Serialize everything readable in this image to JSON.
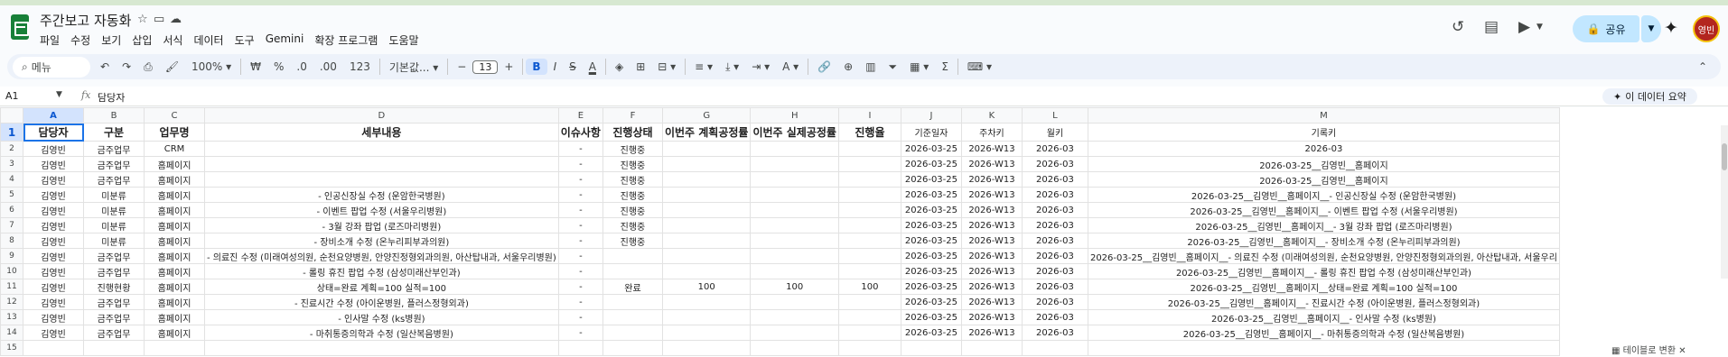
{
  "app": {
    "title": "주간보고 자동화",
    "menus": [
      "파일",
      "수정",
      "보기",
      "삽입",
      "서식",
      "데이터",
      "도구",
      "Gemini",
      "확장 프로그램",
      "도움말"
    ],
    "share_label": "공유",
    "avatar_text": "영빈"
  },
  "toolbar": {
    "search_placeholder": "메뉴",
    "zoom": "100%",
    "currency": "₩",
    "percent": "%",
    "dec_decrease": ".0",
    "dec_increase": ".00",
    "number_format": "123",
    "font": "기본값...",
    "font_size": "13",
    "bold": "B",
    "italic": "I",
    "strike": "S",
    "text_color": "A"
  },
  "formula": {
    "cell_ref": "A1",
    "value": "담당자",
    "summary_button": "이 데이터 요약"
  },
  "sheet": {
    "columns": [
      "A",
      "B",
      "C",
      "D",
      "E",
      "F",
      "G",
      "H",
      "I",
      "J",
      "K",
      "L",
      "M"
    ],
    "headers": [
      "담당자",
      "구분",
      "업무명",
      "세부내용",
      "이슈사항",
      "진행상태",
      "이번주 계획공정률",
      "이번주 실제공정률",
      "진행율",
      "기준일자",
      "주차키",
      "월키",
      "기록키"
    ],
    "rows": [
      [
        "김영빈",
        "금주업무",
        "CRM",
        "",
        "-",
        "진행중",
        "",
        "",
        "",
        "2026-03-25",
        "2026-W13",
        "2026-03",
        "2026-03"
      ],
      [
        "김영빈",
        "금주업무",
        "홈페이지",
        "",
        "-",
        "진행중",
        "",
        "",
        "",
        "2026-03-25",
        "2026-W13",
        "2026-03",
        "2026-03-25__김영빈__홈페이지"
      ],
      [
        "김영빈",
        "금주업무",
        "홈페이지",
        "",
        "-",
        "진행중",
        "",
        "",
        "",
        "2026-03-25",
        "2026-W13",
        "2026-03",
        "2026-03-25__김영빈__홈페이지"
      ],
      [
        "김영빈",
        "미분류",
        "홈페이지",
        "- 인공신장실 수정 (운암한국병원)",
        "-",
        "진행중",
        "",
        "",
        "",
        "2026-03-25",
        "2026-W13",
        "2026-03",
        "2026-03-25__김영빈__홈페이지__- 인공신장실 수정 (운암한국병원)"
      ],
      [
        "김영빈",
        "미분류",
        "홈페이지",
        "- 이벤트 팝업 수정 (서울우리병원)",
        "-",
        "진행중",
        "",
        "",
        "",
        "2026-03-25",
        "2026-W13",
        "2026-03",
        "2026-03-25__김영빈__홈페이지__- 이벤트 팝업 수정 (서울우리병원)"
      ],
      [
        "김영빈",
        "미분류",
        "홈페이지",
        "- 3월 강좌 팝업 (로즈마리병원)",
        "-",
        "진행중",
        "",
        "",
        "",
        "2026-03-25",
        "2026-W13",
        "2026-03",
        "2026-03-25__김영빈__홈페이지__- 3월 강좌 팝업 (로즈마리병원)"
      ],
      [
        "김영빈",
        "미분류",
        "홈페이지",
        "- 장비소개 수정 (온누리피부과의원)",
        "-",
        "진행중",
        "",
        "",
        "",
        "2026-03-25",
        "2026-W13",
        "2026-03",
        "2026-03-25__김영빈__홈페이지__- 장비소개 수정 (온누리피부과의원)"
      ],
      [
        "김영빈",
        "금주업무",
        "홈페이지",
        "- 의료진 수정 (미래여성의원, 순천요양병원, 안양진정형외과의원, 아산탑내과, 서울우리병원)",
        "-",
        "",
        "",
        "",
        "",
        "2026-03-25",
        "2026-W13",
        "2026-03",
        "2026-03-25__김영빈__홈페이지__- 의료진 수정 (미래여성의원, 순천요양병원, 안양진정형외과의원, 아산탑내과, 서울우리"
      ],
      [
        "김영빈",
        "금주업무",
        "홈페이지",
        "- 롤링 휴진 팝업 수정 (삼성미래산부인과)",
        "-",
        "",
        "",
        "",
        "",
        "2026-03-25",
        "2026-W13",
        "2026-03",
        "2026-03-25__김영빈__홈페이지__- 롤링 휴진 팝업 수정 (삼성미래산부인과)"
      ],
      [
        "김영빈",
        "진행현황",
        "홈페이지",
        "상태=완료 계획=100 실적=100",
        "-",
        "완료",
        "100",
        "100",
        "100",
        "2026-03-25",
        "2026-W13",
        "2026-03",
        "2026-03-25__김영빈__홈페이지__상태=완료 계획=100 실적=100"
      ],
      [
        "김영빈",
        "금주업무",
        "홈페이지",
        "- 진료시간 수정 (아이운병원, 플러스정형외과)",
        "-",
        "",
        "",
        "",
        "",
        "2026-03-25",
        "2026-W13",
        "2026-03",
        "2026-03-25__김영빈__홈페이지__- 진료시간 수정 (아이운병원, 플러스정형외과)"
      ],
      [
        "김영빈",
        "금주업무",
        "홈페이지",
        "- 인사말 수정 (ks병원)",
        "-",
        "",
        "",
        "",
        "",
        "2026-03-25",
        "2026-W13",
        "2026-03",
        "2026-03-25__김영빈__홈페이지__- 인사말 수정 (ks병원)"
      ],
      [
        "김영빈",
        "금주업무",
        "홈페이지",
        "- 마취통증의학과 수정 (일산복음병원)",
        "-",
        "",
        "",
        "",
        "",
        "2026-03-25",
        "2026-W13",
        "2026-03",
        "2026-03-25__김영빈__홈페이지__- 마취통증의학과 수정 (일산복음병원)"
      ],
      [
        "",
        "",
        "",
        "",
        "",
        "",
        "",
        "",
        "",
        "",
        "",
        "",
        ""
      ]
    ],
    "row_numbers": [
      "1",
      "2",
      "3",
      "4",
      "5",
      "6",
      "7",
      "8",
      "9",
      "10",
      "11",
      "12",
      "13",
      "14",
      "15"
    ],
    "table_convert_label": "테이블로 변환"
  },
  "colors": {
    "accent": "#0b57d0",
    "selection": "#d3e3fd",
    "share_bg": "#c2e7ff",
    "sheets_green": "#188038"
  }
}
